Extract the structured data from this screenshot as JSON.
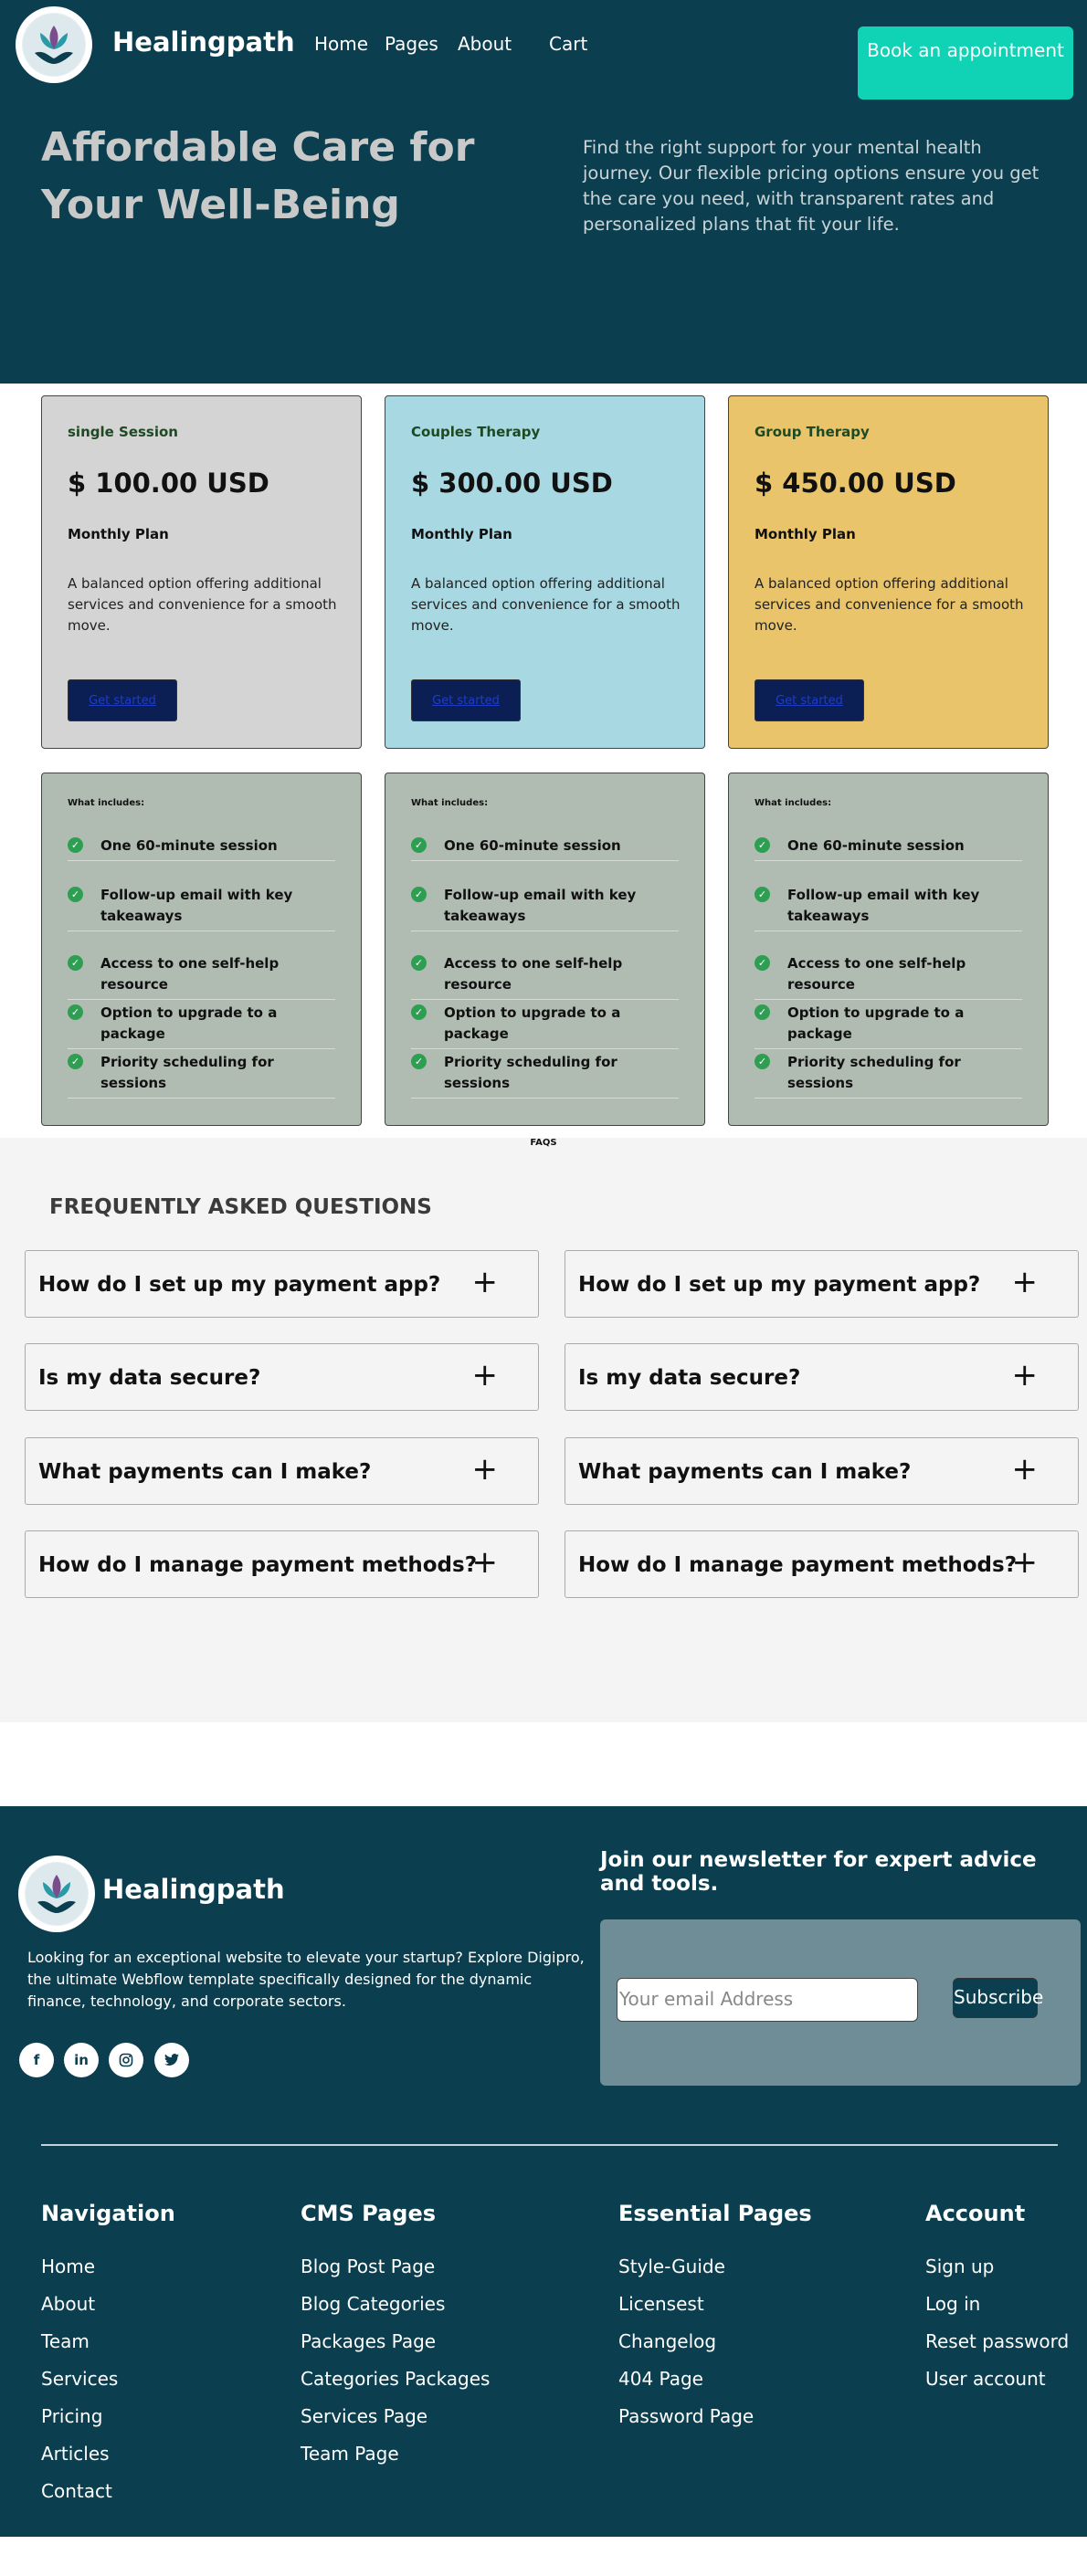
{
  "header": {
    "brand": "Healingpath",
    "nav": [
      "Home",
      "Pages",
      "About",
      "Cart"
    ],
    "book_button": "Book an appointment"
  },
  "hero": {
    "title": "Affordable Care for Your Well-Being",
    "text": "Find the right support for your mental health journey. Our flexible pricing options ensure you get the care you need, with transparent rates and personalized plans that fit your life."
  },
  "pricing": {
    "cards": [
      {
        "name": "single Session",
        "price": "$ 100.00 USD",
        "plan": "Monthly Plan",
        "desc": "A balanced option offering additional services and convenience for a smooth move.",
        "button": "Get started",
        "color": "#d4d4d4"
      },
      {
        "name": "Couples Therapy",
        "price": "$ 300.00 USD",
        "plan": "Monthly Plan",
        "desc": "A balanced option offering additional services and convenience for a smooth move.",
        "button": "Get started",
        "color": "#a8d8e2"
      },
      {
        "name": "Group Therapy",
        "price": "$ 450.00 USD",
        "plan": "Monthly Plan",
        "desc": "A balanced option offering additional services and convenience for a smooth move.",
        "button": "Get started",
        "color": "#e9c46a"
      }
    ],
    "features_heading": "What includes:",
    "features": [
      "One 60-minute session",
      "Follow-up email with key takeaways",
      "Access to one self-help resource",
      "Option to upgrade to a package",
      "Priority scheduling for sessions"
    ]
  },
  "faq": {
    "label": "FAQS",
    "title": "FREQUENTLY ASKED QUESTIONS",
    "questions": [
      "How do I set up my payment app?",
      "Is my data secure?",
      "What payments can I make?",
      "How do I manage payment methods?"
    ],
    "toggle_icon": "+"
  },
  "footer": {
    "brand": "Healingpath",
    "description": "Looking for an exceptional website to elevate your startup? Explore Digipro, the ultimate Webflow template specifically designed for the dynamic finance, technology, and corporate sectors.",
    "social": [
      "facebook-icon",
      "linkedin-icon",
      "instagram-icon",
      "twitter-icon"
    ],
    "newsletter_title": "Join our newsletter for expert advice and tools.",
    "email_placeholder": "Your email Address",
    "subscribe": "Subscribe",
    "columns": [
      {
        "title": "Navigation",
        "links": [
          "Home",
          "About",
          "Team",
          "Services",
          "Pricing",
          "Articles",
          "Contact"
        ]
      },
      {
        "title": "CMS Pages",
        "links": [
          "Blog Post Page",
          "Blog Categories",
          "Packages Page",
          "Categories Packages",
          "Services Page",
          "Team Page"
        ]
      },
      {
        "title": "Essential Pages",
        "links": [
          "Style-Guide",
          "Licensest",
          "Changelog",
          "404 Page",
          "Password Page"
        ]
      },
      {
        "title": "Account",
        "links": [
          "Sign up",
          "Log in",
          "Reset password",
          "User account"
        ]
      }
    ]
  }
}
